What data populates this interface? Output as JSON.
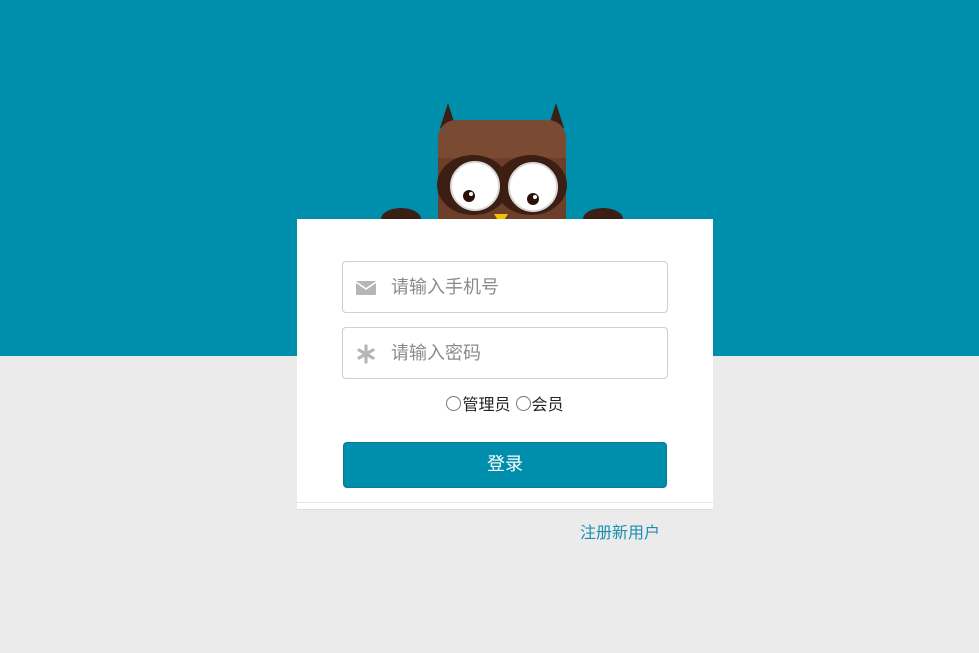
{
  "login_form": {
    "phone_placeholder": "请输入手机号",
    "phone_icon": "envelope-icon",
    "password_placeholder": "请输入密码",
    "password_icon": "asterisk-icon",
    "role_options": [
      {
        "label": "管理员",
        "checked": false
      },
      {
        "label": "会员",
        "checked": false
      }
    ],
    "submit_label": "登录",
    "register_link": "注册新用户"
  },
  "colors": {
    "brand": "#008ead",
    "background": "#ebebeb",
    "card": "#ffffff",
    "link": "#1b8fb0"
  }
}
